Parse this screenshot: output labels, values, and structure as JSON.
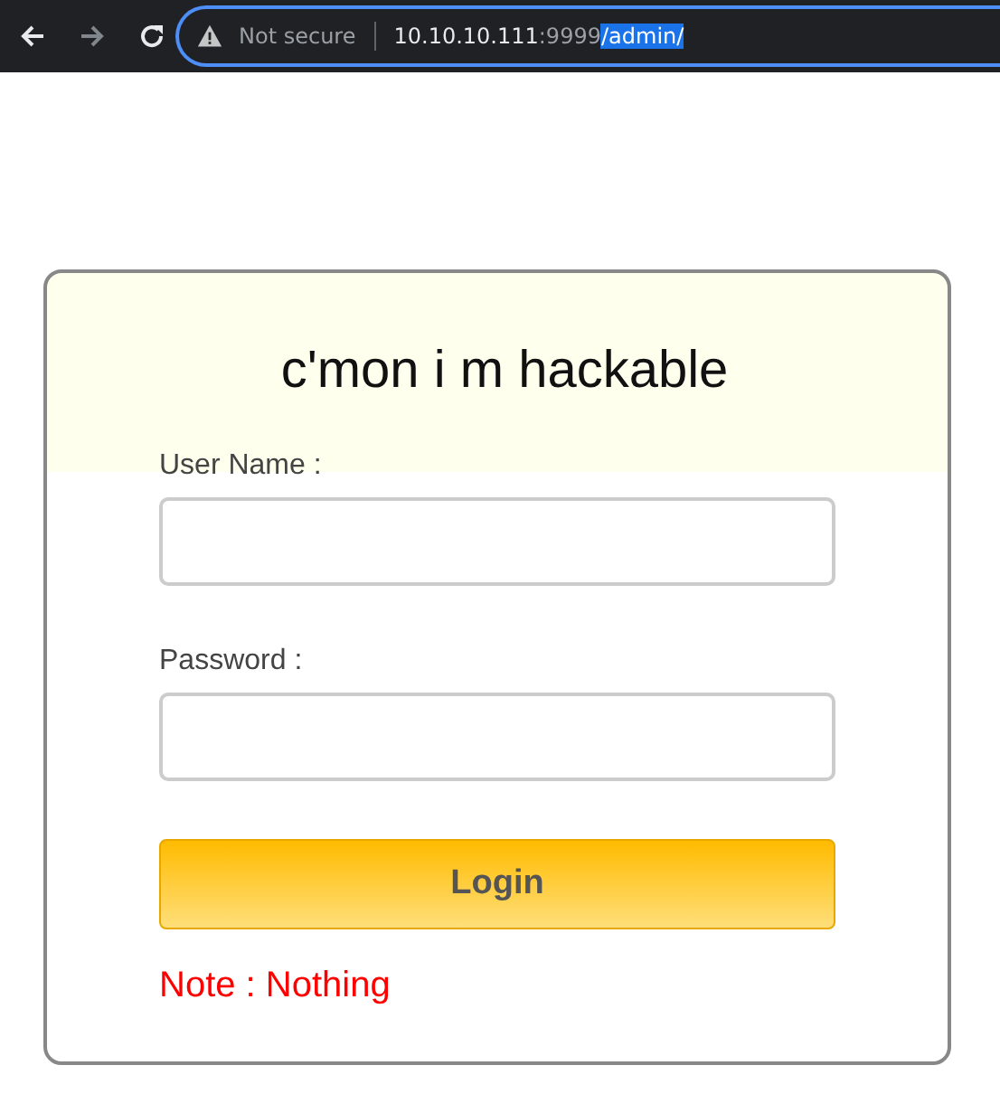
{
  "browser": {
    "security_label": "Not secure",
    "address": {
      "host": "10.10.10.111",
      "port": ":9999",
      "path": "/admin/",
      "path_selected": true
    }
  },
  "login": {
    "title": "c'mon i m hackable",
    "fields": [
      {
        "label": "User Name :"
      },
      {
        "label": "Password :"
      }
    ],
    "button": "Login",
    "note": "Note : Nothing"
  }
}
